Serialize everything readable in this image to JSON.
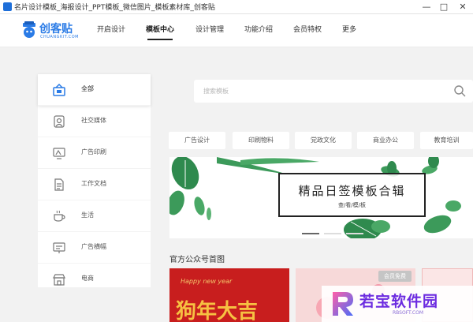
{
  "window": {
    "title": "名片设计模板_海报设计_PPT模板_微信图片_模板素材库_创客贴",
    "min": "—",
    "max": "□",
    "close": "✕"
  },
  "logo": {
    "brand": "创客贴",
    "sub": "CHUANGKIT.COM"
  },
  "nav": [
    "开启设计",
    "模板中心",
    "设计管理",
    "功能介绍",
    "会员特权",
    "更多"
  ],
  "nav_active": "模板中心",
  "sidebar": {
    "items": [
      {
        "label": "全部",
        "icon": "all-templates-icon"
      },
      {
        "label": "社交媒体",
        "icon": "social-media-icon"
      },
      {
        "label": "广告印刷",
        "icon": "ad-print-icon"
      },
      {
        "label": "工作文档",
        "icon": "work-document-icon"
      },
      {
        "label": "生活",
        "icon": "life-cup-icon"
      },
      {
        "label": "广告横幅",
        "icon": "ad-banner-icon"
      },
      {
        "label": "电商",
        "icon": "ecommerce-shop-icon"
      }
    ]
  },
  "search": {
    "placeholder": "搜索模板"
  },
  "categories": [
    "广告设计",
    "印刷物料",
    "党政文化",
    "商业办公",
    "教育培训"
  ],
  "banner": {
    "title": "精品日签模板合辑",
    "subtitle": "查/看/模/板"
  },
  "section": {
    "title": "官方公众号首图"
  },
  "cards": {
    "happy": "Happy new year",
    "big": "狗年大吉",
    "badge": "会员免费"
  },
  "watermark": {
    "text": "若宝软件园",
    "domain": "RBSOFT.COM"
  },
  "colors": {
    "accent": "#2a7be6",
    "watermark": "#6c2ce0",
    "leaf": "#2f8a4e"
  }
}
